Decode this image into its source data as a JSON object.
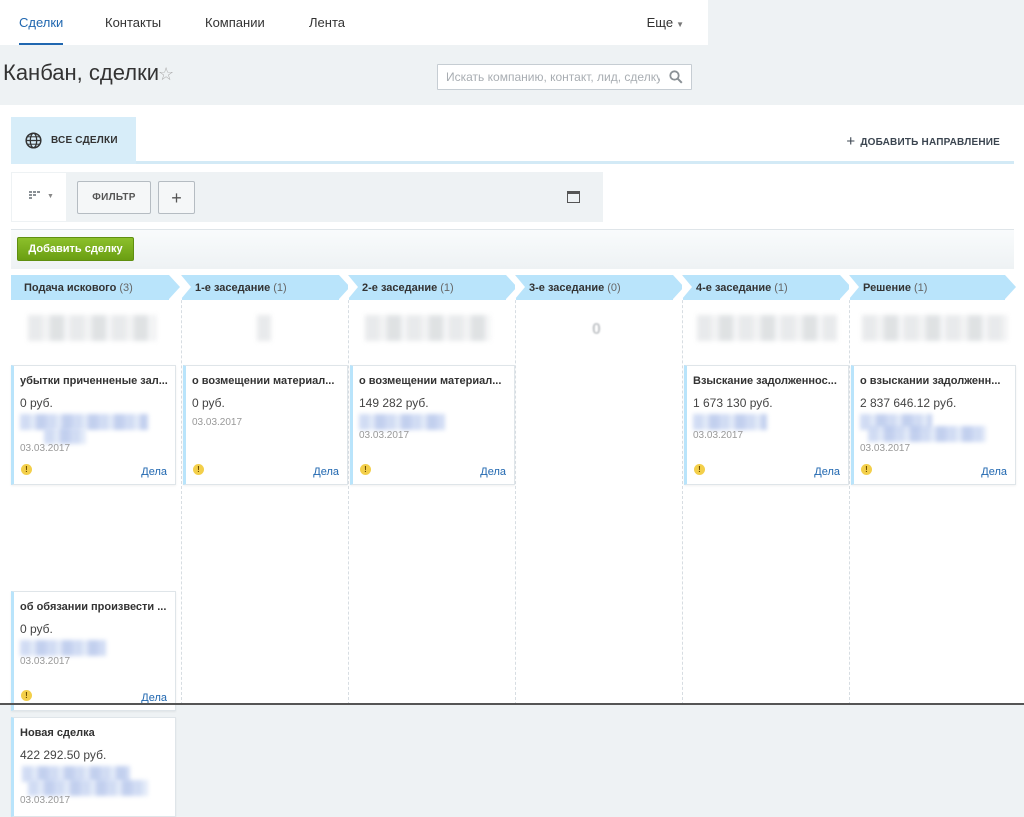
{
  "nav": {
    "tabs": [
      {
        "label": "Сделки",
        "active": true
      },
      {
        "label": "Контакты",
        "active": false
      },
      {
        "label": "Компании",
        "active": false
      },
      {
        "label": "Лента",
        "active": false
      }
    ],
    "more_label": "Еще"
  },
  "header": {
    "title": "Канбан, сделки",
    "search_placeholder": "Искать компанию, контакт, лид, сделку"
  },
  "directions": {
    "active_tab": "ВСЕ СДЕЛКИ",
    "add_label": "ДОБАВИТЬ НАПРАВЛЕНИЕ"
  },
  "toolbar": {
    "filter_label": "ФИЛЬТР",
    "plus_label": "+"
  },
  "actions": {
    "add_deal_label": "Добавить сделку"
  },
  "colors": {
    "accent": "#2067b0",
    "stage": "#b9e4fb",
    "add_button": "#7aaf1e",
    "warn": "#f3cf4a"
  },
  "stages": [
    {
      "name": "Подача искового",
      "count": "(3)",
      "cards": [
        {
          "title": "убытки приченненые зал...",
          "amount": "0 руб.",
          "date": "03.03.2017",
          "tasks": "Дела"
        },
        {
          "title": "об обязании произвести ...",
          "amount": "0 руб.",
          "date": "03.03.2017",
          "tasks": "Дела"
        },
        {
          "title": "Новая сделка",
          "amount": "422 292.50 руб.",
          "date": "03.03.2017",
          "tasks": "Дела"
        }
      ]
    },
    {
      "name": "1-е заседание",
      "count": "(1)",
      "cards": [
        {
          "title": "о возмещении материал...",
          "amount": "0 руб.",
          "date": "03.03.2017",
          "tasks": "Дела"
        }
      ]
    },
    {
      "name": "2-е заседание",
      "count": "(1)",
      "cards": [
        {
          "title": "о возмещении материал...",
          "amount": "149 282 руб.",
          "date": "03.03.2017",
          "tasks": "Дела"
        }
      ]
    },
    {
      "name": "3-е заседание",
      "count": "(0)",
      "total": "0",
      "cards": []
    },
    {
      "name": "4-е заседание",
      "count": "(1)",
      "cards": [
        {
          "title": "Взыскание задолженнос...",
          "amount": "1 673 130 руб.",
          "date": "03.03.2017",
          "tasks": "Дела"
        }
      ]
    },
    {
      "name": "Решение",
      "count": "(1)",
      "cards": [
        {
          "title": "о взыскании задолженн...",
          "amount": "2 837 646.12 руб.",
          "date": "03.03.2017",
          "tasks": "Дела"
        }
      ]
    }
  ]
}
